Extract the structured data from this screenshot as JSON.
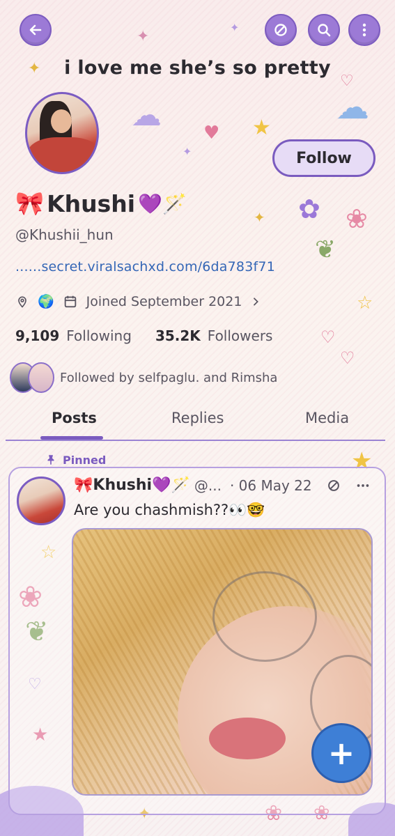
{
  "header": {
    "back_icon": "arrow-left-icon",
    "actions": [
      "not-interested-icon",
      "search-icon",
      "more-vertical-icon"
    ],
    "bio_line": "i love me she’s so pretty"
  },
  "profile": {
    "follow_label": "Follow",
    "name_prefix_emoji": "🎀",
    "name": "Khushi",
    "name_suffix_emoji": "💜🪄",
    "handle": "@Khushii_hun",
    "link_dots": "......",
    "link": "secret.viralsachxd.com/6da783f71",
    "location_emoji": "🌍",
    "joined": "Joined September 2021",
    "following_count": "9,109",
    "following_label": "Following",
    "followers_count": "35.2K",
    "followers_label": "Followers",
    "followed_by": "Followed by selfpaglu. and Rimsha"
  },
  "tabs": [
    {
      "label": "Posts",
      "active": true
    },
    {
      "label": "Replies",
      "active": false
    },
    {
      "label": "Media",
      "active": false
    }
  ],
  "pinned_post": {
    "pinned_label": "Pinned",
    "author_prefix": "🎀",
    "author": "Khushi",
    "author_suffix": "💜🪄",
    "handle_truncated": "@...",
    "date": "· 06 May 22",
    "text": "Are you chashmish??👀🤓"
  },
  "fab_label": "+",
  "colors": {
    "accent_purple": "#7a5bbf",
    "link_blue": "#3466b6",
    "fab_blue": "#3e7fd6"
  }
}
